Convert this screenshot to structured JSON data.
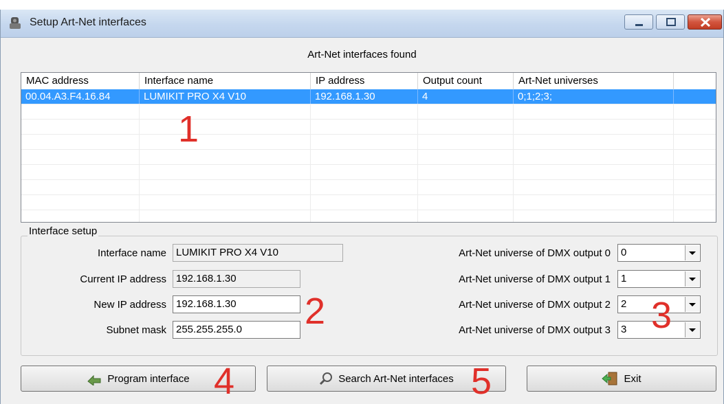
{
  "window": {
    "title": "Setup Art-Net interfaces"
  },
  "caption": "Art-Net interfaces found",
  "table": {
    "columns": [
      "MAC address",
      "Interface name",
      "IP address",
      "Output count",
      "Art-Net universes"
    ],
    "rows": [
      {
        "mac": "00.04.A3.F4.16.84",
        "name": "LUMIKIT PRO X4 V10",
        "ip": "192.168.1.30",
        "outputs": "4",
        "universes": "0;1;2;3;",
        "selected": true
      }
    ]
  },
  "setup": {
    "label": "Interface setup",
    "interface_name_label": "Interface name",
    "interface_name_value": "LUMIKIT PRO X4 V10",
    "current_ip_label": "Current IP address",
    "current_ip_value": "192.168.1.30",
    "new_ip_label": "New IP address",
    "new_ip_value": "192.168.1.30",
    "subnet_label": "Subnet mask",
    "subnet_value": "255.255.255.0",
    "outputs": [
      {
        "label": "Art-Net universe of DMX output 0",
        "value": "0"
      },
      {
        "label": "Art-Net universe of DMX output 1",
        "value": "1"
      },
      {
        "label": "Art-Net universe of DMX output 2",
        "value": "2"
      },
      {
        "label": "Art-Net universe of DMX output 3",
        "value": "3"
      }
    ]
  },
  "buttons": {
    "program": "Program interface",
    "search": "Search Art-Net interfaces",
    "exit": "Exit"
  },
  "annotations": [
    "1",
    "2",
    "3",
    "4",
    "5"
  ],
  "colors": {
    "selection": "#3399ff",
    "annotation": "#e0302a"
  }
}
